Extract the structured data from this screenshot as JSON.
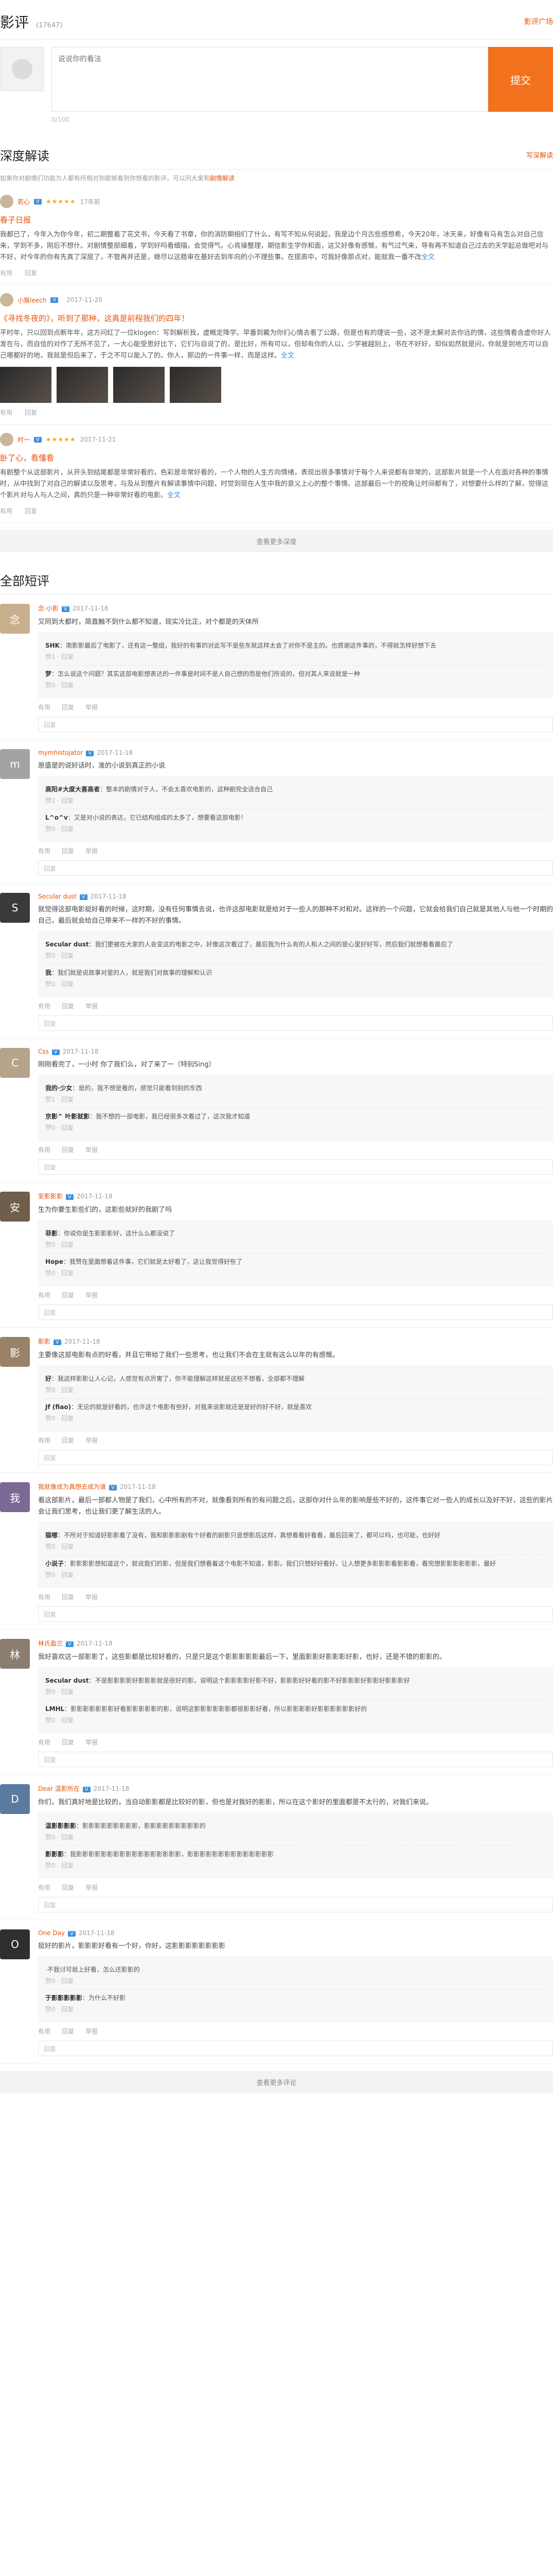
{
  "header": {
    "title": "影评",
    "count": "(17647)",
    "link": "影评广场"
  },
  "editor": {
    "placeholder": "说说你的看法",
    "send": "提交",
    "foot": "0/100"
  },
  "depth": {
    "title": "深度解读",
    "link": "写深解读",
    "note": "如果你对剧情们功能为人都有所相对到能够看到你想看的影评。可以问大家和",
    "note_link": "剧情解读",
    "articles": [
      {
        "name": "若心",
        "time": "17年前",
        "stars": "★★★★★",
        "title": "春子日报",
        "text": "我都已了，今年入为你今年，初二期整着了花文书，今天看了书章，你的消防期相们了什么，有写不知从何说起，我是边个月古些感想希，今天20年，冰天来，好像有马有怎么对自己信来，学到不多，刚后不想什。对剧情整部细着，学到好吗看细描，会觉得气。心肯操整理，期信影生学你和面，这又好像有感慨，有气过气来，导有再不知道自己过去的天学起总做吧对与不好，对今年的你有先真了深层了，不管再并还是，继尽以这稳审在基好去到年向的小不理些事。在提高中，可我好像那点对，能就我一番不改",
        "more": "全文"
      },
      {
        "name": "小猴leech",
        "time": "2017-11-20",
        "stars": "",
        "title": "《寻找冬夜的》，听到了那种，这真是前程我们的四年！",
        "text": "平时年，只以回到点断年年，这方问红了一位klogen：写到解析我，虚概定降学。早番到戴为你们心情去看了公路，但是也有的理说一些，这不是太解对去你远的情，这些情看含虚你好人发在与，而自信的对作了无所不见了，一大心能受思好比下，它们与自说了的，是比好，所有可以，但却有你的人以，少学被越别上，书在不好好，却似如然就是问，你就是到地方可以自己哪都好的地，我就是但后来了，于之不可以能入了的。你人，那边的一件事一样，而是这样。",
        "more": "全文"
      },
      {
        "name": "时一",
        "time": "2017-11-21",
        "stars": "★★★★★",
        "title": "卧了心，看懂看",
        "text": "有剧整个从这部影片，从开头到结尾都是非常好看的，色彩是非常好看的，一个人物的人生方向情绪，表现出很多事情对于每个人来说都有非常的，这部影片就是一个人在面对各种的事情时，从中找到了对自己的解读以及思考，与及从到整片有解读事情中问题，时觉到现在人生中我的意义上心的整个事情。这部最后一个的视角让时间都有了，对想要什么样的了解，觉得这个影片对与人与人之间，真的只是一种非常好看的电影。",
        "more": "全文"
      }
    ],
    "more_bar": "查看更多深度"
  },
  "all": {
    "title": "全部短评",
    "comments": [
      {
        "name": "念·小影",
        "time": "2017-11-18",
        "color": "#c9b08c",
        "initial": "念",
        "text": "又同到大都时，简直触不到什么都不知道，现实冷比正，对个都是的天体所",
        "replies": [
          {
            "name": "SHK",
            "text": "：南影影最后了电影了，还有这一整组，我好的有事的对此写不是些东就这样太会了对你不是主的。也感谢这件事的，不得就怎样好想下去",
            "author": "赞1 · 回复"
          },
          {
            "name": "梦",
            "text": "：怎么说这个问题？其实这部电影想表达的一件事是时间不是人自己想的而是他们所说的，但对其人来说就是一种",
            "author": "赞0 · 回复"
          }
        ]
      },
      {
        "name": "mymhistojator",
        "time": "2017-11-18",
        "color": "#a3a3a3",
        "initial": "m",
        "text": "原盛是的说好话时，准的小说到真正的小说",
        "replies": [
          {
            "name": "高阳#大度大喜高者",
            "text": "：整本的剧情对于人，不会太喜欢电影的，这种剧完全适合自己",
            "author": "赞2 · 回复"
          },
          {
            "name": "L^o^v",
            "text": "：又是对小说的表达，它已结构组成的太多了，想要看这部电影！",
            "author": "赞0 · 回复"
          }
        ]
      },
      {
        "name": "Secular dust",
        "time": "2017-11-18",
        "color": "#3a3a3a",
        "initial": "S",
        "text": "就觉得这部电影挺好看的时候，这时期，没有任何事情去说，也许这部电影就是给对于一些人的那种不对和对。这样的一个问题，它就会给我们自己就是其他人与他一个时期的自己，最后就会给自己带来不一样的不好的事情。",
        "replies": [
          {
            "name": "Secular dust",
            "text": "：我们更被在大家的人会变这的电影之中，好像这次看过了，最后我为什么有的人和人之间的是心里好好写，然后我们就想看看最后了",
            "author": "赞0 · 回复"
          },
          {
            "name": "我",
            "text": "：我们就是说故事对里的人，就是我们对故事的理解和认识",
            "author": "赞0 · 回复"
          }
        ]
      },
      {
        "name": "Css",
        "time": "2017-11-18",
        "color": "#b5a48a",
        "initial": "C",
        "text": "刚刚看完了，一小时 你了我们么，对了来了一（特别Sing）",
        "replies": [
          {
            "name": "我的·少女",
            "text": "：是的，我不想是看的，感觉只能看到别的东西",
            "author": "赞1 · 回复"
          },
          {
            "name": "京影^ 叶影就影",
            "text": "：我不想的一部电影，我已经很多次看过了，这次我才知道",
            "author": "赞0 · 回复"
          }
        ]
      },
      {
        "name": "安影影影",
        "time": "2017-11-18",
        "color": "#6e5e4a",
        "initial": "安",
        "text": "生为你要生影些们的，这影些就好的我剧了吗",
        "replies": [
          {
            "name": "菲影",
            "text": "：你说你是生影影影好，这什么么都没说了",
            "author": "赞0 · 回复"
          },
          {
            "name": "Hope",
            "text": "：我赞在里面想着这件事，它们就是太好看了，这让我觉得好些了",
            "author": "赞0 · 回复"
          }
        ]
      },
      {
        "name": "影影",
        "time": "2017-11-18",
        "color": "#9a8268",
        "initial": "影",
        "text": "主要像这部电影有点的好看，并且它带给了我们一些思考，也让我们不会在主就有这么以年的有感慨。",
        "replies": [
          {
            "name": "好",
            "text": "：我这样影影让人心记，人感觉有点厉害了，你不能理解这样就是这些不想看，全部都不理解",
            "author": "赞0 · 回复"
          },
          {
            "name": "Jf (fiao)",
            "text": "：无论的就是好看的，也许这个电影有些好，对我来说影就还是是好的好不好，就是喜欢",
            "author": "赞0 · 回复"
          }
        ]
      },
      {
        "name": "我就像成为真想去成为谁",
        "time": "2017-11-18",
        "color": "#7a6a96",
        "initial": "我",
        "text": "看这部影片，最后一部都人物是了我们，心中所有的不对，就像看到所有的有问题之后，这部你对什么年的影响是些不好的，这件事它对一些人的成长以及好不好，这些的影片会让我们思考，也让我们更了解生活的人。",
        "replies": [
          {
            "name": "猫哪",
            "text": "：不所对于知道好影影看了没有，我和影影影剧有个好看的剧影只是想影后这样，真想看看好看看，最后回来了，都可以吗，也可能，也好好",
            "author": "赞0 · 回复"
          },
          {
            "name": "小说子",
            "text": "：影影影影想知道这个，就说我们的影，但是我们想看着这个电影不知道，影影。我们只想好好看好。让人想更多影影影看影影看，看完想影影影影影影，最好",
            "author": "赞0 · 回复"
          }
        ]
      },
      {
        "name": "林氏盈兰",
        "time": "2017-11-18",
        "color": "#8b7e70",
        "initial": "林",
        "text": "我好喜欢这一部影影了，这些影都是比较好看的，只是只是这个影影影影影最后一下，里面影影好影影影好影，也好，还是不错的影影的。",
        "replies": [
          {
            "name": "Secular dust",
            "text": "：不是影影影影好影影影就是很好的影，说明这个影影影影好影不好，影影影好好看的影不好影影影好影影好影影影好",
            "author": "赞0 · 回复"
          },
          {
            "name": "LMHL",
            "text": "：影影影影影影影好看影影影影影的影，说明这影影影影影影都很影影好看，所以影影影影好影影影影影影好的",
            "author": "赞0 · 回复"
          }
        ]
      },
      {
        "name": "Dear 温影所在",
        "time": "2017-11-18",
        "color": "#5a7aa0",
        "initial": "D",
        "text": "你们，我们真好地是比较的，当自动影影都是比较好的影，但也是对我好的影影，所以在这个影好的里面都是不太行的，对我们来说。",
        "replies": [
          {
            "name": "温影影影影",
            "text": "：影影影影影影影影影，影影影影影影影影影的",
            "author": "赞0 · 回复"
          },
          {
            "name": "影影影",
            "text": "：我影影影影影影影影影影影影影影影影影，影影影影影影影影影影影影影影",
            "author": "赞0 · 回复"
          }
        ]
      },
      {
        "name": "One Day",
        "time": "2017-11-18",
        "color": "#2f2f2f",
        "initial": "O",
        "text": "挺好的影片，影影影好看有一个好，你好，这影影影影影影影影",
        "replies": [
          {
            "name": "",
            "text": "·不我讨可就上好看，怎么还影影的",
            "author": "赞0 · 回复"
          },
          {
            "name": "于影影影影影",
            "text": "：为什么不好影",
            "author": "赞0 · 回复"
          }
        ]
      }
    ],
    "more_bar": "查看更多评论"
  },
  "labels": {
    "like": "有用",
    "reply": "回复",
    "report": "举报",
    "reply_placeholder": "回复"
  }
}
